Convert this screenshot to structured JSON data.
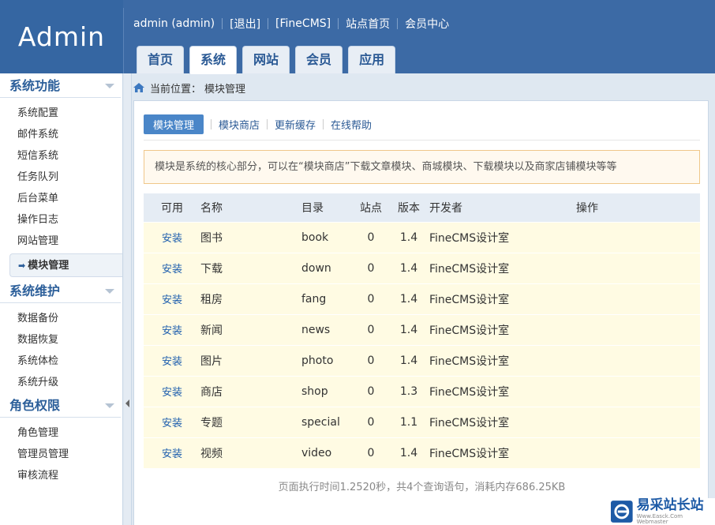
{
  "header": {
    "logo": "Admin",
    "topbar": [
      "admin (admin)",
      "[退出]",
      "[FineCMS]",
      "站点首页",
      "会员中心"
    ],
    "tabs": [
      "首页",
      "系统",
      "网站",
      "会员",
      "应用"
    ]
  },
  "sidebar": {
    "groups": [
      {
        "title": "系统功能",
        "items": [
          "系统配置",
          "邮件系统",
          "短信系统",
          "任务队列",
          "后台菜单",
          "操作日志",
          "网站管理"
        ]
      },
      {
        "title": "系统维护",
        "items": [
          "数据备份",
          "数据恢复",
          "系统体检",
          "系统升级"
        ]
      },
      {
        "title": "角色权限",
        "items": [
          "角色管理",
          "管理员管理",
          "审核流程"
        ]
      }
    ],
    "active_item": "模块管理"
  },
  "breadcrumb": {
    "label": "当前位置：",
    "current": "模块管理"
  },
  "subnav": [
    "模块管理",
    "模块商店",
    "更新缓存",
    "在线帮助"
  ],
  "notice": "模块是系统的核心部分，可以在“模块商店”下载文章模块、商城模块、下载模块以及商家店铺模块等等",
  "table": {
    "headers": [
      "可用",
      "名称",
      "目录",
      "站点",
      "版本",
      "开发者",
      "操作"
    ],
    "rows": [
      {
        "action": "安装",
        "name": "图书",
        "dir": "book",
        "site": "0",
        "version": "1.4",
        "dev": "FineCMS设计室"
      },
      {
        "action": "安装",
        "name": "下载",
        "dir": "down",
        "site": "0",
        "version": "1.4",
        "dev": "FineCMS设计室"
      },
      {
        "action": "安装",
        "name": "租房",
        "dir": "fang",
        "site": "0",
        "version": "1.4",
        "dev": "FineCMS设计室"
      },
      {
        "action": "安装",
        "name": "新闻",
        "dir": "news",
        "site": "0",
        "version": "1.4",
        "dev": "FineCMS设计室"
      },
      {
        "action": "安装",
        "name": "图片",
        "dir": "photo",
        "site": "0",
        "version": "1.4",
        "dev": "FineCMS设计室"
      },
      {
        "action": "安装",
        "name": "商店",
        "dir": "shop",
        "site": "0",
        "version": "1.3",
        "dev": "FineCMS设计室"
      },
      {
        "action": "安装",
        "name": "专题",
        "dir": "special",
        "site": "0",
        "version": "1.1",
        "dev": "FineCMS设计室"
      },
      {
        "action": "安装",
        "name": "视频",
        "dir": "video",
        "site": "0",
        "version": "1.4",
        "dev": "FineCMS设计室"
      }
    ]
  },
  "footer": "页面执行时间1.2520秒，共4个查询语句，消耗内存686.25KB",
  "watermark": {
    "title": "易采站长站",
    "sub": "Www.Easck.Com Webmaster"
  }
}
